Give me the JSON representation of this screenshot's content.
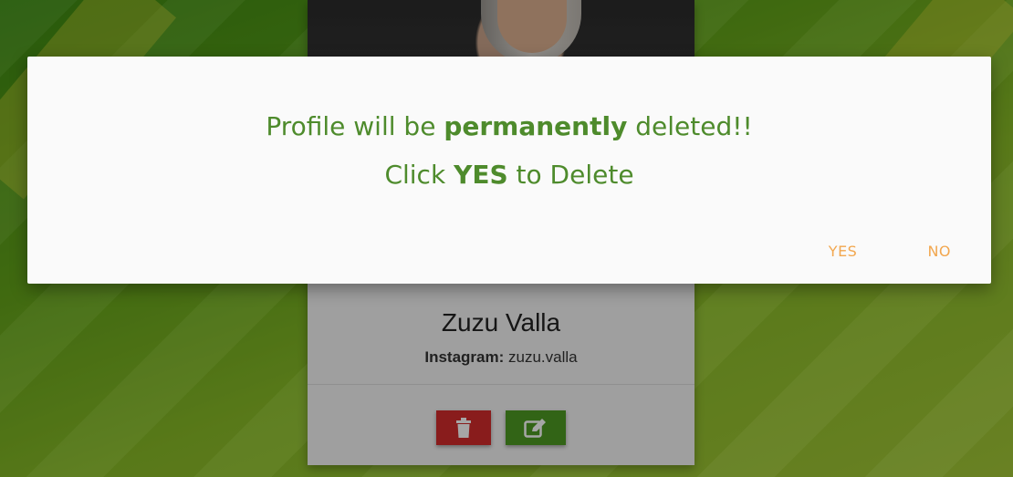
{
  "card": {
    "name": "Zuzu Valla",
    "instagram_label": "Instagram:",
    "instagram_handle": "zuzu.valla",
    "delete_icon": "trash-icon",
    "edit_icon": "edit-icon"
  },
  "modal": {
    "line1_pre": "Profile will be ",
    "line1_bold": "permanently",
    "line1_post": " deleted!!",
    "line2_pre": "Click ",
    "line2_bold": "YES",
    "line2_post": " to Delete",
    "yes_label": "YES",
    "no_label": "NO"
  },
  "colors": {
    "modal_text": "#4e8b2c",
    "modal_buttons": "#f2a74f",
    "delete_button": "#d32b2b",
    "edit_button": "#4e9a22"
  }
}
